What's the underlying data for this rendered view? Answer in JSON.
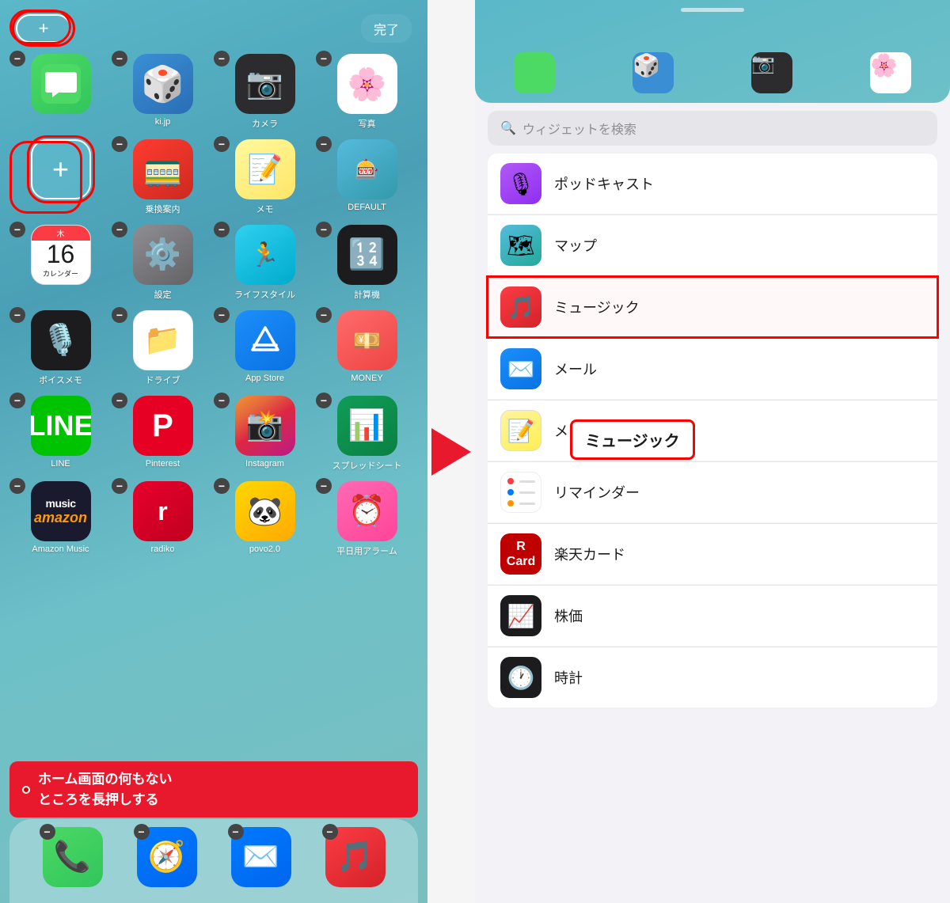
{
  "left": {
    "done_label": "完了",
    "add_plus": "+",
    "apps_row1": [
      {
        "id": "messages",
        "icon": "messages",
        "label": ""
      },
      {
        "id": "tenki",
        "icon": "tenki",
        "label": "ki.jp"
      },
      {
        "id": "camera",
        "icon": "camera",
        "label": "カメラ"
      },
      {
        "id": "photos",
        "icon": "photos",
        "label": "写真"
      }
    ],
    "apps_row2": [
      {
        "id": "add-widget",
        "icon": "add",
        "label": ""
      },
      {
        "id": "transit",
        "icon": "transit",
        "label": "乗換案内"
      },
      {
        "id": "memo",
        "icon": "memo",
        "label": "メモ"
      },
      {
        "id": "default",
        "icon": "default",
        "label": "DEFAULT"
      }
    ],
    "apps_row3": [
      {
        "id": "calendar",
        "icon": "calendar",
        "label": "カレンダー"
      },
      {
        "id": "settings",
        "icon": "settings",
        "label": "設定"
      },
      {
        "id": "lifestyle",
        "icon": "lifestyle",
        "label": "ライフスタイル"
      },
      {
        "id": "calc",
        "icon": "calc",
        "label": "計算機"
      }
    ],
    "apps_row4": [
      {
        "id": "voice",
        "icon": "voice",
        "label": "ボイスメモ"
      },
      {
        "id": "drive",
        "icon": "drive",
        "label": "ドライブ"
      },
      {
        "id": "appstore",
        "icon": "appstore",
        "label": "App Store"
      },
      {
        "id": "money",
        "icon": "money",
        "label": "MONEY"
      }
    ],
    "apps_row5": [
      {
        "id": "line",
        "icon": "line",
        "label": "LINE"
      },
      {
        "id": "pinterest",
        "icon": "pinterest",
        "label": "Pinterest"
      },
      {
        "id": "instagram",
        "icon": "instagram",
        "label": "Instagram"
      },
      {
        "id": "sheets",
        "icon": "sheets",
        "label": "スプレッドシート"
      }
    ],
    "apps_row6": [
      {
        "id": "amazon",
        "icon": "amazon",
        "label": "Amazon Music"
      },
      {
        "id": "radiko",
        "icon": "radiko",
        "label": "radiko"
      },
      {
        "id": "povo",
        "icon": "povo",
        "label": "povo2.0"
      },
      {
        "id": "alarm",
        "icon": "alarm",
        "label": "平日用アラーム"
      }
    ],
    "dock": [
      {
        "id": "phone",
        "icon": "phone",
        "label": ""
      },
      {
        "id": "safari",
        "icon": "safari",
        "label": ""
      },
      {
        "id": "mail",
        "icon": "mail",
        "label": ""
      },
      {
        "id": "music",
        "icon": "music",
        "label": ""
      }
    ],
    "home_label": "ホーム画面の何もない\nところを長押しする"
  },
  "right": {
    "search_placeholder": "ウィジェットを検索",
    "widgets": [
      {
        "id": "podcasts",
        "icon": "podcasts",
        "label": "ポッドキャスト"
      },
      {
        "id": "maps",
        "icon": "maps",
        "label": "マップ"
      },
      {
        "id": "music",
        "icon": "music",
        "label": "ミュージック",
        "highlighted": true
      },
      {
        "id": "mail",
        "icon": "mail",
        "label": "メール"
      },
      {
        "id": "notes",
        "icon": "notes",
        "label": "メモ"
      },
      {
        "id": "reminders",
        "icon": "reminders",
        "label": "リマインダー"
      },
      {
        "id": "rakuten",
        "icon": "rakuten",
        "label": "楽天カード"
      },
      {
        "id": "stocks",
        "icon": "stocks",
        "label": "株価"
      },
      {
        "id": "clock",
        "icon": "clock",
        "label": "時計"
      }
    ],
    "music_popup": "ミュージック"
  }
}
